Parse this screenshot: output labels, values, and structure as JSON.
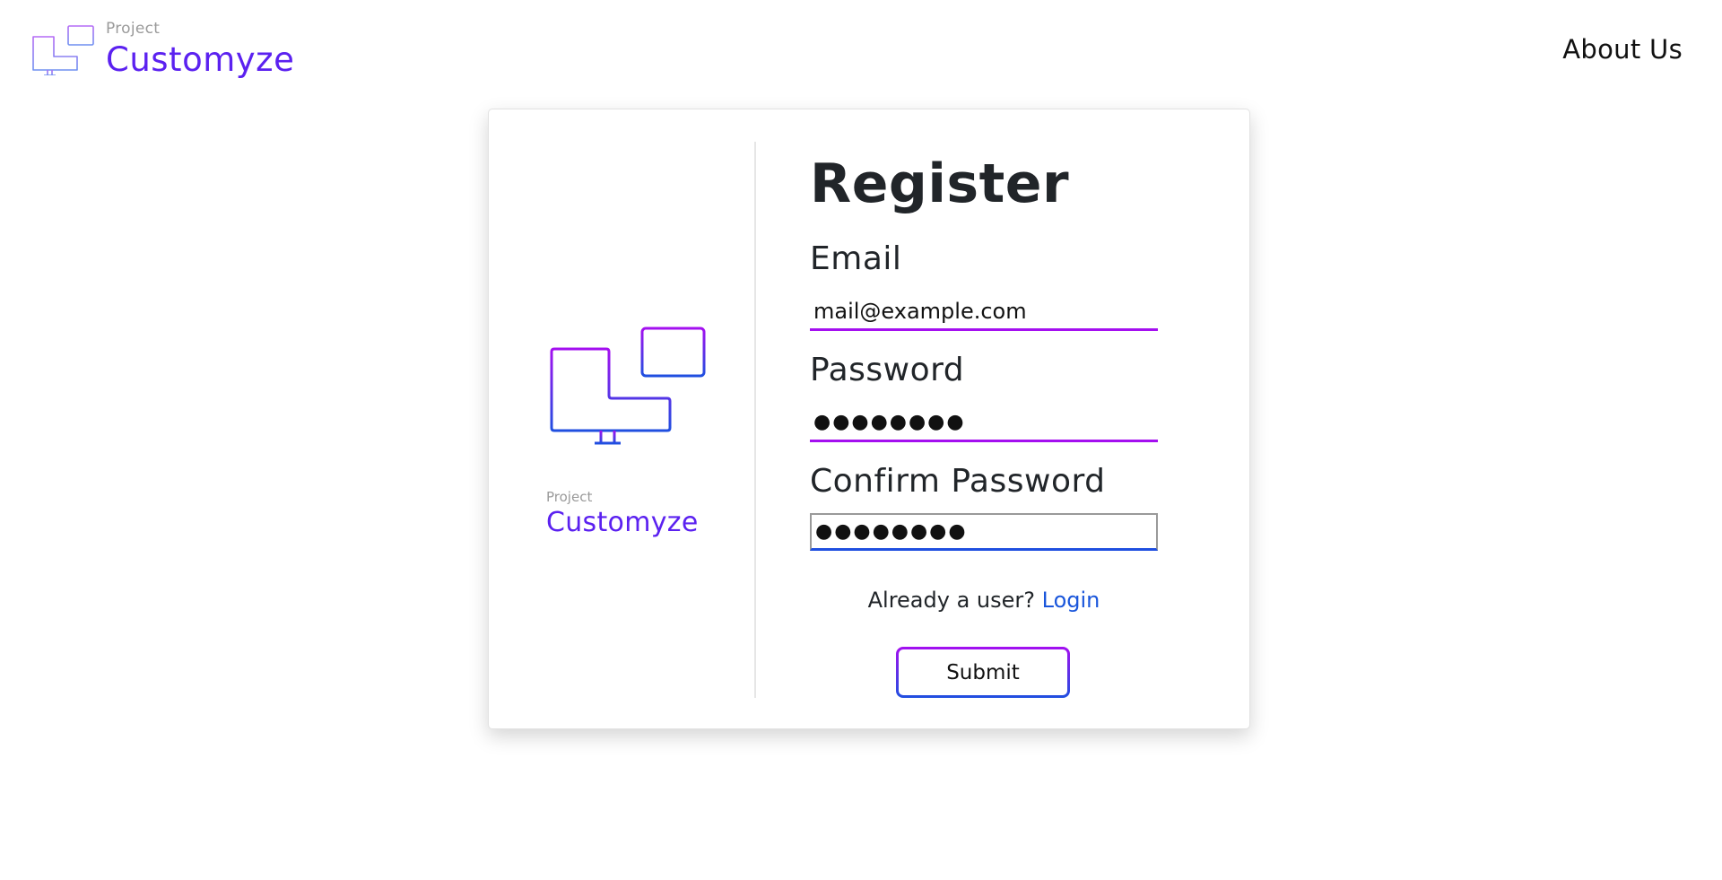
{
  "navbar": {
    "brand_small": "Project",
    "brand_name": "Customyze",
    "about_label": "About Us"
  },
  "side": {
    "brand_small": "Project",
    "brand_name": "Customyze"
  },
  "form": {
    "title": "Register",
    "email_label": "Email",
    "email_value": "mail@example.com",
    "password_label": "Password",
    "password_value": "●●●●●●●●",
    "confirm_label": "Confirm Password",
    "confirm_value": "●●●●●●●●",
    "already_text": "Already a user?",
    "login_label": "Login",
    "submit_label": "Submit"
  },
  "colors": {
    "brand_purple": "#5b21f0",
    "gradient_top": "#a40ff0",
    "gradient_bottom": "#1f4fe0",
    "link_blue": "#1a56db"
  },
  "icons": {
    "brand_logo": "monitor-screens-logo-icon",
    "side_logo": "monitor-screens-logo-icon"
  }
}
